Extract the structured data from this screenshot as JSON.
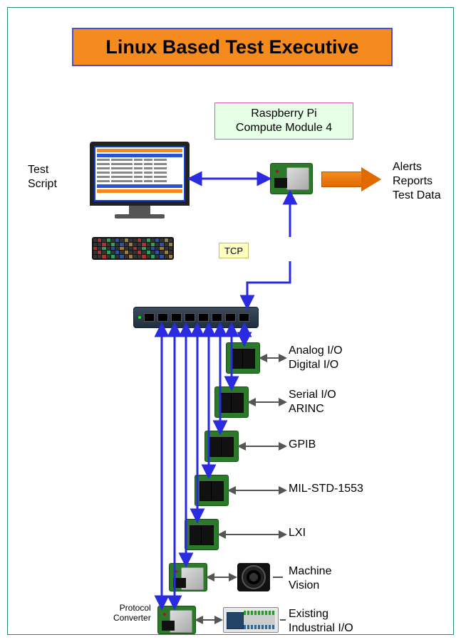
{
  "title": "Linux Based Test Executive",
  "rpi_box": "Raspberry Pi\nCompute Module 4",
  "tcp_label": "TCP",
  "test_script_label": "Test\nScript",
  "outputs_label": "Alerts\nReports\nTest Data",
  "protocol_converter_label": "Protocol\nConverter",
  "modules": [
    {
      "label": "Analog I/O\nDigital I/O"
    },
    {
      "label": "Serial I/O\nARINC"
    },
    {
      "label": "GPIB"
    },
    {
      "label": "MIL-STD-1553"
    },
    {
      "label": "LXI"
    },
    {
      "label": "Machine\nVision"
    },
    {
      "label": "Existing\nIndustrial I/O"
    }
  ],
  "colors": {
    "arrow": "#2a2ae0",
    "arrow_dark": "#1818a0",
    "banner_bg": "#f58a1f",
    "banner_border": "#4a52c4",
    "frame_border": "#2a8a7a"
  }
}
